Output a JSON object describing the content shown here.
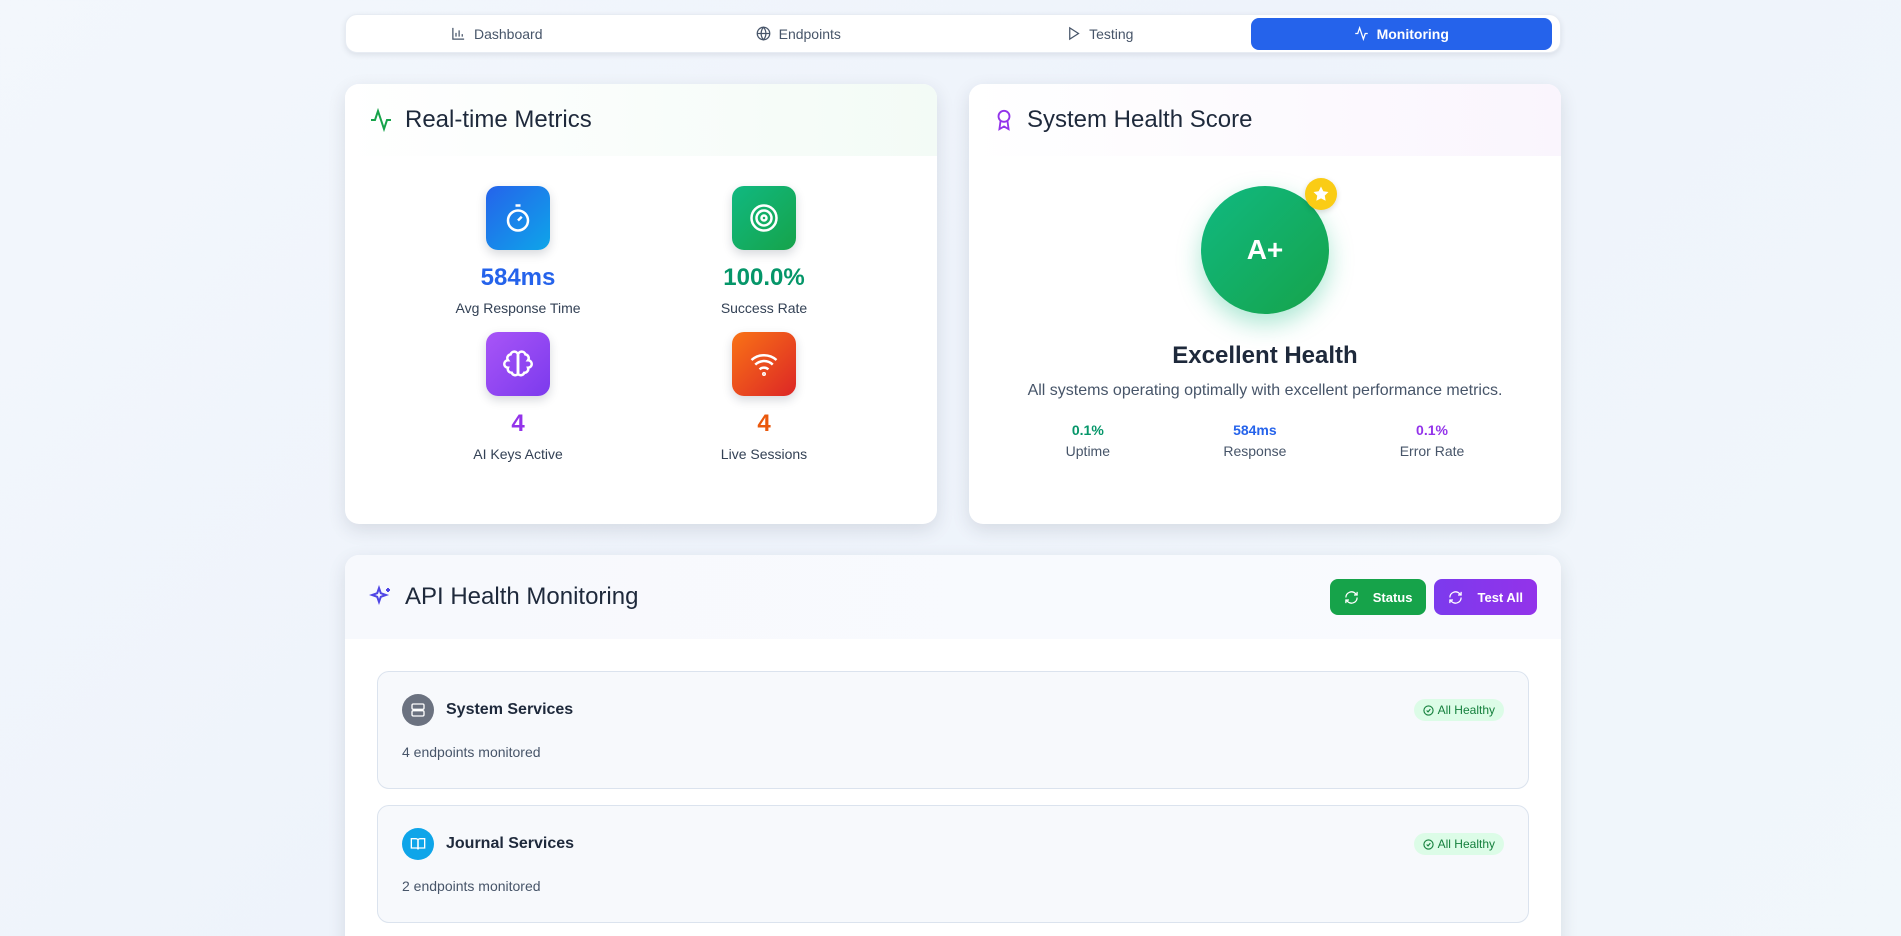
{
  "tabs": [
    {
      "label": "Dashboard",
      "icon": "bar-chart-icon"
    },
    {
      "label": "Endpoints",
      "icon": "globe-icon"
    },
    {
      "label": "Testing",
      "icon": "play-icon"
    },
    {
      "label": "Monitoring",
      "icon": "activity-icon"
    }
  ],
  "active_tab": "Monitoring",
  "metrics_card": {
    "title": "Real-time Metrics",
    "items": [
      {
        "value": "584ms",
        "label": "Avg Response Time",
        "icon": "stopwatch-icon",
        "color": "#2563eb"
      },
      {
        "value": "100.0%",
        "label": "Success Rate",
        "icon": "target-icon",
        "color": "#059669"
      },
      {
        "value": "4",
        "label": "AI Keys Active",
        "icon": "brain-icon",
        "color": "#9333ea"
      },
      {
        "value": "4",
        "label": "Live Sessions",
        "icon": "wifi-icon",
        "color": "#ea580c"
      }
    ]
  },
  "health_card": {
    "title": "System Health Score",
    "grade": "A+",
    "status": "Excellent Health",
    "description": "All systems operating optimally with excellent performance metrics.",
    "stats": [
      {
        "value": "0.1%",
        "label": "Uptime",
        "color": "#059669"
      },
      {
        "value": "584ms",
        "label": "Response",
        "color": "#2563eb"
      },
      {
        "value": "0.1%",
        "label": "Error Rate",
        "color": "#9333ea"
      }
    ]
  },
  "monitoring": {
    "title": "API Health Monitoring",
    "status_button": "Status",
    "test_all_button": "Test All",
    "services": [
      {
        "name": "System Services",
        "subtitle": "4 endpoints monitored",
        "badge": "All Healthy",
        "icon": "server-icon"
      },
      {
        "name": "Journal Services",
        "subtitle": "2 endpoints monitored",
        "badge": "All Healthy",
        "icon": "book-icon"
      }
    ]
  },
  "colors": {
    "accent": "#2563eb",
    "success": "#16a34a",
    "purple": "#9333ea",
    "warning": "#facc15"
  }
}
